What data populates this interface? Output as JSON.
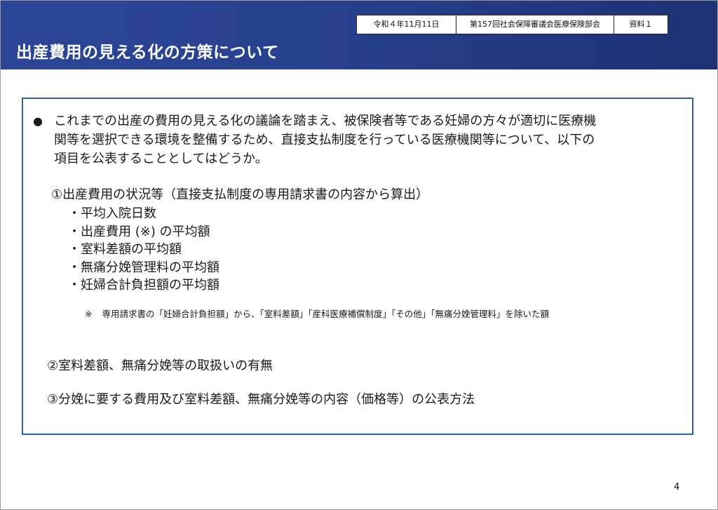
{
  "header": {
    "title": "出産費用の見える化の方策について",
    "date": "令和４年11月11日",
    "committee": "第157回社会保障審議会医療保険部会",
    "doc_label": "資料１"
  },
  "content": {
    "bullet_symbol": "●",
    "paragraph_lines": [
      "これまでの出産の費用の見える化の議論を踏まえ、被保険者等である妊婦の方々が適切に医療機",
      "関等を選択できる環境を整備するため、直接支払制度を行っている医療機関等について、以下の",
      "項目を公表することとしてはどうか。"
    ],
    "section1": {
      "heading": "①出産費用の状況等（直接支払制度の専用請求書の内容から算出）",
      "items": [
        "・平均入院日数",
        "・出産費用 (※) の平均額",
        "・室料差額の平均額",
        "・無痛分娩管理料の平均額",
        "・妊婦合計負担額の平均額"
      ],
      "note_mark": "※",
      "note": "専用請求書の「妊婦合計負担額」から、「室料差額」「産科医療補償制度」「その他」「無痛分娩管理料」を除いた額"
    },
    "section2": "②室料差額、無痛分娩等の取扱いの有無",
    "section3": "③分娩に要する費用及び室料差額、無痛分娩等の内容（価格等）の公表方法"
  },
  "page_number": "4",
  "colors": {
    "header_bg": "#28418e",
    "box_border": "#2c5fa3",
    "text": "#1a1a1a"
  }
}
